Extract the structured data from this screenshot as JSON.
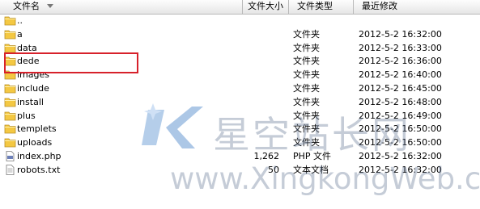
{
  "columns": {
    "name": "文件名",
    "size": "文件大小",
    "type": "文件类型",
    "modified": "最近修改"
  },
  "files": [
    {
      "icon": "folder-up-icon",
      "name": "..",
      "size": "",
      "type": "",
      "date": ""
    },
    {
      "icon": "folder-icon",
      "name": "a",
      "size": "",
      "type": "文件夹",
      "date": "2012-5-2 16:32:00"
    },
    {
      "icon": "folder-icon",
      "name": "data",
      "size": "",
      "type": "文件夹",
      "date": "2012-5-2 16:33:00"
    },
    {
      "icon": "folder-icon",
      "name": "dede",
      "size": "",
      "type": "文件夹",
      "date": "2012-5-2 16:36:00"
    },
    {
      "icon": "folder-icon",
      "name": "images",
      "size": "",
      "type": "文件夹",
      "date": "2012-5-2 16:40:00"
    },
    {
      "icon": "folder-icon",
      "name": "include",
      "size": "",
      "type": "文件夹",
      "date": "2012-5-2 16:45:00"
    },
    {
      "icon": "folder-icon",
      "name": "install",
      "size": "",
      "type": "文件夹",
      "date": "2012-5-2 16:48:00"
    },
    {
      "icon": "folder-icon",
      "name": "plus",
      "size": "",
      "type": "文件夹",
      "date": "2012-5-2 16:49:00"
    },
    {
      "icon": "folder-icon",
      "name": "templets",
      "size": "",
      "type": "文件夹",
      "date": "2012-5-2 16:50:00"
    },
    {
      "icon": "folder-icon",
      "name": "uploads",
      "size": "",
      "type": "文件夹",
      "date": "2012-5-2 16:50:00"
    },
    {
      "icon": "php-file-icon",
      "name": "index.php",
      "size": "1,262",
      "type": "PHP 文件",
      "date": "2012-5-2 16:32:00"
    },
    {
      "icon": "text-file-icon",
      "name": "robots.txt",
      "size": "50",
      "type": "文本文档",
      "date": "2012-5-2 16:32:00"
    }
  ],
  "highlighted_item": "dede",
  "watermark": {
    "chinese": "星空站长网",
    "english": "www.XingkongWeb.com"
  },
  "colors": {
    "folder": "#f4c842",
    "highlight_border": "#d7212b",
    "watermark": "#5a6e8c",
    "header_border": "#b9b9b9"
  }
}
